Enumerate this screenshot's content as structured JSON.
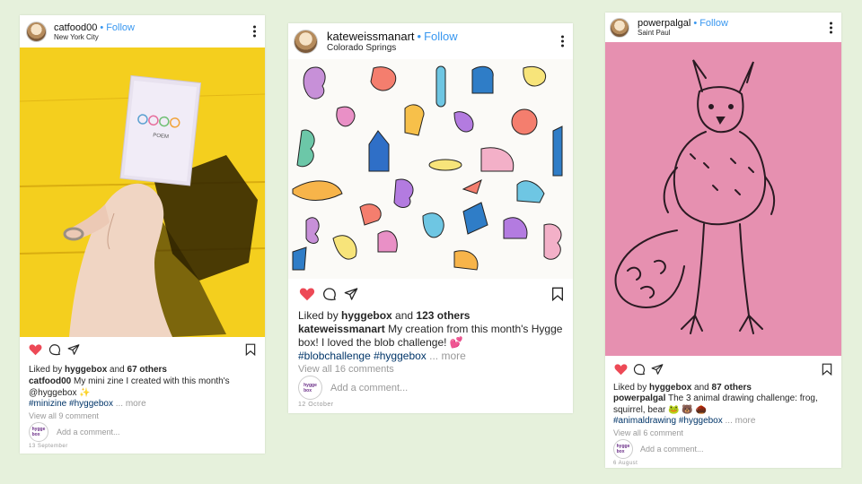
{
  "posts": [
    {
      "username": "catfood00",
      "follow_label": "Follow",
      "location": "New York City",
      "zine_cover_text": "STAMP POEM",
      "liked_by_prefix": "Liked by ",
      "liked_by_user": "hyggebox",
      "liked_by_suffix": " and ",
      "liked_by_count": "67 others",
      "caption_user": "catfood00",
      "caption_text": " My mini zine I created with this month's @hyggebox ✨",
      "hashtags": "#minizine #hyggebox",
      "more_label": " ... more",
      "view_comments": "View all 9 comment",
      "add_comment_placeholder": "Add a comment...",
      "date": "13 September"
    },
    {
      "username": "kateweissmanart",
      "follow_label": "Follow",
      "location": "Colorado Springs",
      "liked_by_prefix": "Liked by ",
      "liked_by_user": "hyggebox",
      "liked_by_suffix": " and ",
      "liked_by_count": "123 others",
      "caption_user": "kateweissmanart",
      "caption_text": " My creation from this month's Hygge box! I loved the blob challenge! 💕",
      "hashtags": "#blobchallenge #hyggebox",
      "more_label": " ... more",
      "view_comments": "View all 16 comments",
      "add_comment_placeholder": "Add a comment...",
      "date": "12 October"
    },
    {
      "username": "powerpalgal",
      "follow_label": "Follow",
      "location": "Saint Paul",
      "liked_by_prefix": "Liked by ",
      "liked_by_user": "hyggebox",
      "liked_by_suffix": " and ",
      "liked_by_count": "87 others",
      "caption_user": "powerpalgal",
      "caption_text": " The 3 animal drawing challenge: frog, squirrel, bear 🐸 🐻 🌰",
      "hashtags": "#animaldrawing #hyggebox",
      "more_label": " ... more",
      "view_comments": "View all 6 comment",
      "add_comment_placeholder": "Add a comment...",
      "date": "6 August"
    }
  ],
  "hygge_avatar_text": "hygge box",
  "colors": {
    "background": "#e6f1dc",
    "follow": "#3897f0",
    "heart": "#ed4956",
    "hashtag": "#003569",
    "yellow_wall": "#f4cf1e",
    "pink_paper": "#e690b0"
  }
}
